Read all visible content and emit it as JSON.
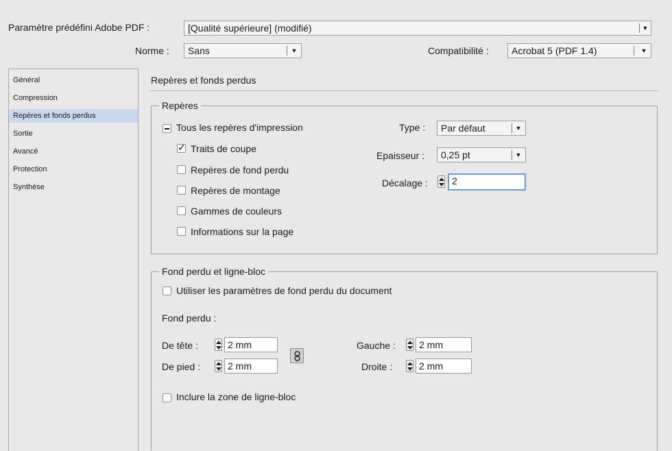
{
  "header": {
    "preset_label": "Paramètre prédéfini Adobe PDF :",
    "preset_value": "[Qualité supérieure] (modifié)",
    "standard_label": "Norme :",
    "standard_value": "Sans",
    "compat_label": "Compatibilité :",
    "compat_value": "Acrobat 5 (PDF 1.4)"
  },
  "sidebar": {
    "items": [
      {
        "label": "Général"
      },
      {
        "label": "Compression"
      },
      {
        "label": "Repères et fonds perdus"
      },
      {
        "label": "Sortie"
      },
      {
        "label": "Avancé"
      },
      {
        "label": "Protection"
      },
      {
        "label": "Synthèse"
      }
    ],
    "active_index": 2
  },
  "main": {
    "section_title": "Repères et fonds perdus",
    "marks": {
      "legend": "Repères",
      "all_marks_label": "Tous les repères d'impression",
      "checkboxes": [
        {
          "label": "Traits de coupe",
          "checked": true
        },
        {
          "label": "Repères de fond perdu",
          "checked": false
        },
        {
          "label": "Repères de montage",
          "checked": false
        },
        {
          "label": "Gammes de couleurs",
          "checked": false
        },
        {
          "label": "Informations sur la page",
          "checked": false
        }
      ],
      "type_label": "Type :",
      "type_value": "Par défaut",
      "weight_label": "Epaisseur :",
      "weight_value": "0,25 pt",
      "offset_label": "Décalage :",
      "offset_value": "2"
    },
    "bleed": {
      "legend": "Fond perdu et ligne-bloc",
      "use_doc_label": "Utiliser les paramètres de fond perdu du document",
      "bleed_label": "Fond perdu :",
      "top_label": "De tête :",
      "top_value": "2 mm",
      "bottom_label": "De pied :",
      "bottom_value": "2 mm",
      "left_label": "Gauche :",
      "left_value": "2 mm",
      "right_label": "Droite :",
      "right_value": "2 mm",
      "slug_label": "Inclure la zone de ligne-bloc"
    }
  },
  "colors": {
    "background": "#e8e8e8",
    "selection": "#c9d8ef",
    "focus_ring": "#6e97d6"
  }
}
